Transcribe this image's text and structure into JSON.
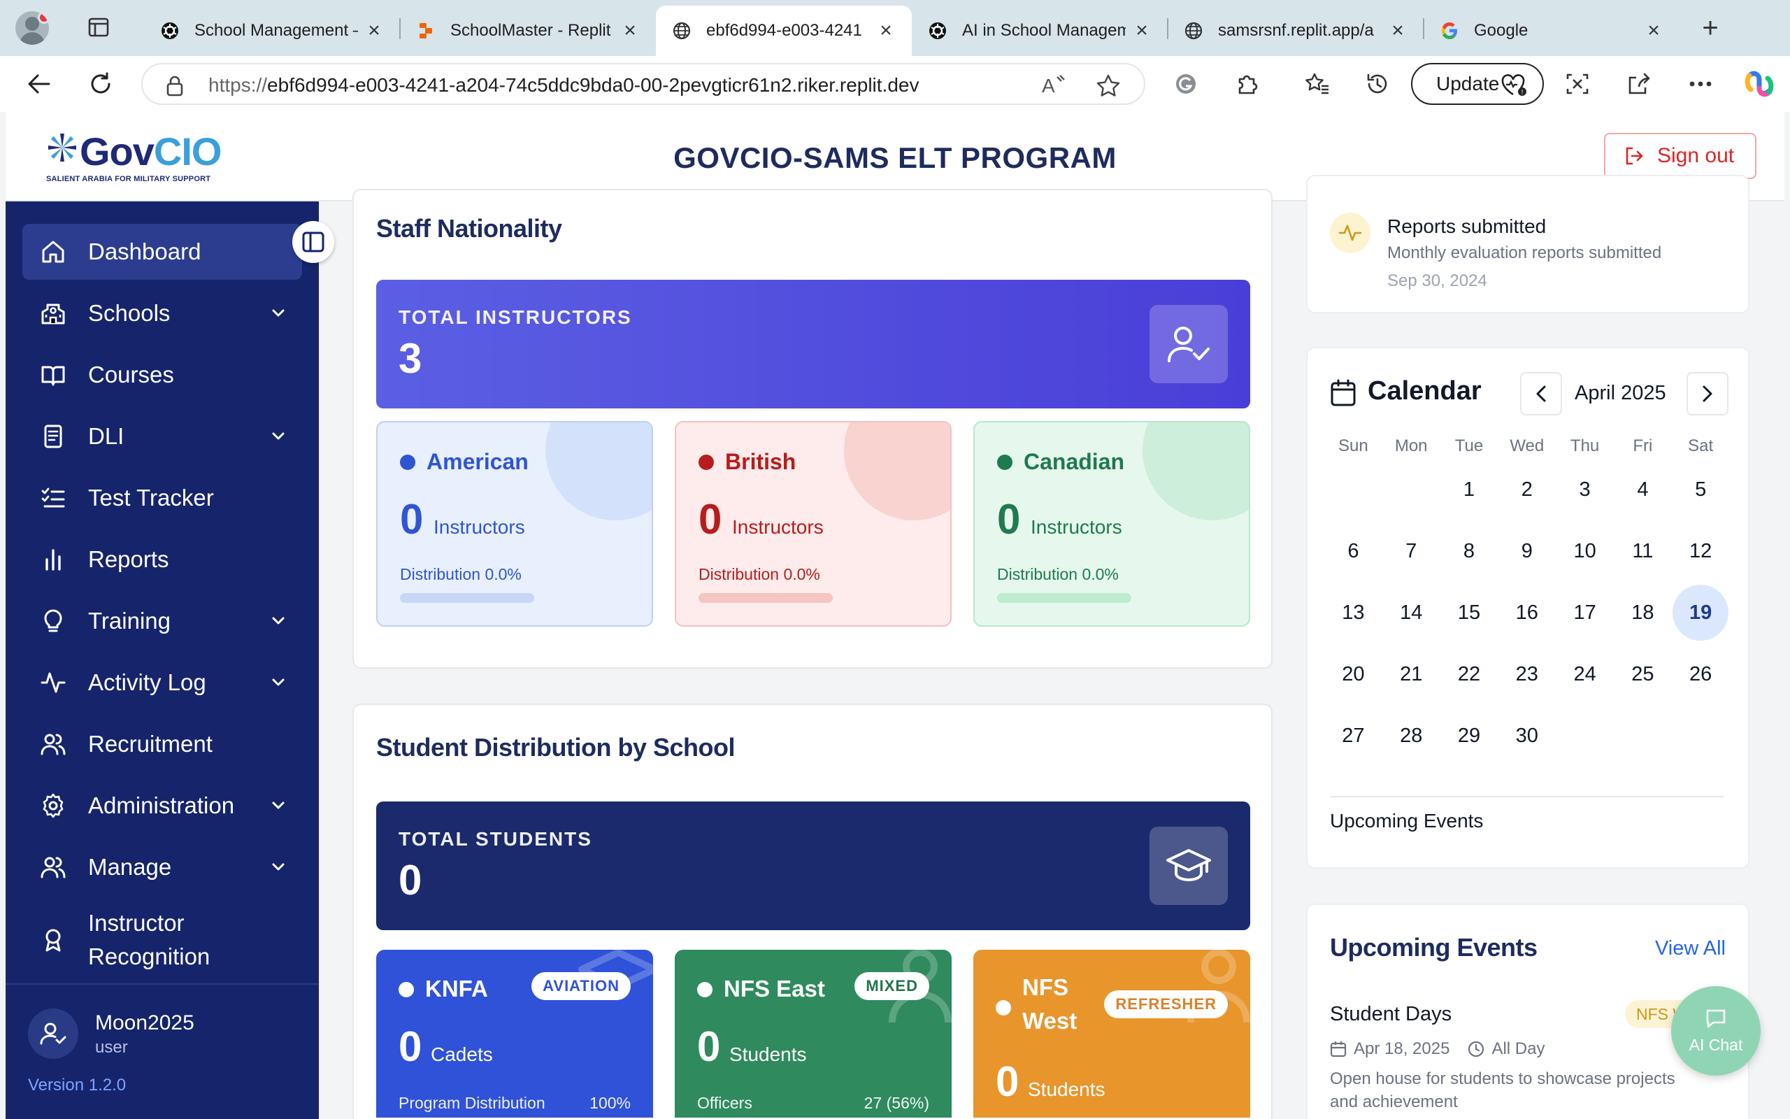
{
  "browser": {
    "tabs": [
      {
        "title": "School Management —",
        "icon": "openai-icon",
        "active": false
      },
      {
        "title": "SchoolMaster - Replit",
        "icon": "replit-icon",
        "active": false
      },
      {
        "title": "ebf6d994-e003-4241",
        "icon": "globe-icon",
        "active": true
      },
      {
        "title": "AI in School Managem",
        "icon": "openai-icon",
        "active": false
      },
      {
        "title": "samsrsnf.replit.app/a",
        "icon": "globe-icon",
        "active": false
      },
      {
        "title": "Google",
        "icon": "google-icon",
        "active": false
      }
    ],
    "url_proto": "https://",
    "url_rest": "ebf6d994-e003-4241-a204-74c5ddc9bda0-00-2pevgticr61n2.riker.replit.dev",
    "update_label": "Update"
  },
  "header": {
    "logo_gov": "Gov",
    "logo_cio": "CIO",
    "logo_tagline": "SALIENT ARABIA FOR MILITARY SUPPORT",
    "title": "GOVCIO-SAMS ELT PROGRAM",
    "signout_label": "Sign out"
  },
  "sidebar": {
    "items": [
      {
        "label": "Dashboard",
        "icon": "home-icon",
        "active": true,
        "expandable": false
      },
      {
        "label": "Schools",
        "icon": "school-icon",
        "active": false,
        "expandable": true
      },
      {
        "label": "Courses",
        "icon": "book-open-icon",
        "active": false,
        "expandable": false
      },
      {
        "label": "DLI",
        "icon": "document-icon",
        "active": false,
        "expandable": true
      },
      {
        "label": "Test Tracker",
        "icon": "checklist-icon",
        "active": false,
        "expandable": false
      },
      {
        "label": "Reports",
        "icon": "bar-chart-icon",
        "active": false,
        "expandable": false
      },
      {
        "label": "Training",
        "icon": "lightbulb-icon",
        "active": false,
        "expandable": true
      },
      {
        "label": "Activity Log",
        "icon": "activity-icon",
        "active": false,
        "expandable": true
      },
      {
        "label": "Recruitment",
        "icon": "users-icon",
        "active": false,
        "expandable": false
      },
      {
        "label": "Administration",
        "icon": "gear-icon",
        "active": false,
        "expandable": true
      },
      {
        "label": "Manage",
        "icon": "users-icon",
        "active": false,
        "expandable": true
      },
      {
        "label": "Instructor Recognition",
        "icon": "award-icon",
        "active": false,
        "expandable": false
      }
    ],
    "user_name": "Moon2025",
    "user_role": "user",
    "version": "Version 1.2.0"
  },
  "staff_nationality": {
    "title": "Staff Nationality",
    "banner_label": "TOTAL INSTRUCTORS",
    "banner_value": "3",
    "cards": [
      {
        "name": "American",
        "count": "0",
        "unit": "Instructors",
        "dist_label": "Distribution",
        "dist_value": "0.0%",
        "fraction": 0.0,
        "color": "#2f55d4",
        "bg": "#e8f0fd",
        "border": "#bcd0f5",
        "bubble": "#d3e1fb",
        "track": "#c8d7f6"
      },
      {
        "name": "British",
        "count": "0",
        "unit": "Instructors",
        "dist_label": "Distribution",
        "dist_value": "0.0%",
        "fraction": 0.0,
        "color": "#b91c1c",
        "bg": "#fdeceb",
        "border": "#f5c1bd",
        "bubble": "#f8d3d0",
        "track": "#f4c5c1"
      },
      {
        "name": "Canadian",
        "count": "0",
        "unit": "Instructors",
        "dist_label": "Distribution",
        "dist_value": "0.0%",
        "fraction": 0.0,
        "color": "#1f7a4f",
        "bg": "#e6f8ee",
        "border": "#b6e8cb",
        "bubble": "#cdeedb",
        "track": "#bdeccf"
      }
    ]
  },
  "student_distribution": {
    "title": "Student Distribution by School",
    "banner_label": "TOTAL STUDENTS",
    "banner_value": "0",
    "cards": [
      {
        "name": "KNFA",
        "tag": "AVIATION",
        "count": "0",
        "unit": "Cadets",
        "foot_left": "Program Distribution",
        "foot_right": "100%",
        "color": "#2f52d9",
        "tag_color": "#2f52d9"
      },
      {
        "name": "NFS East",
        "tag": "MIXED",
        "count": "0",
        "unit": "Students",
        "foot_left": "Officers",
        "foot_right": "27 (56%)",
        "color": "#2f8a5e",
        "tag_color": "#22754d"
      },
      {
        "name": "NFS West",
        "tag": "REFRESHER",
        "count": "0",
        "unit": "Students",
        "foot_left": "",
        "foot_right": "",
        "color": "#e8952c",
        "tag_color": "#d9822b"
      }
    ]
  },
  "recent_activity": {
    "title": "Reports submitted",
    "subtitle": "Monthly evaluation reports submitted",
    "date": "Sep 30, 2024"
  },
  "calendar": {
    "title": "Calendar",
    "month": "April 2025",
    "weekdays": [
      "Sun",
      "Mon",
      "Tue",
      "Wed",
      "Thu",
      "Fri",
      "Sat"
    ],
    "today": 19,
    "days_in_month": 30,
    "first_weekday": 2,
    "upcoming_label": "Upcoming Events"
  },
  "upcoming_events": {
    "title": "Upcoming Events",
    "view_all": "View All",
    "event": {
      "title": "Student Days",
      "badge": "NFS W",
      "date": "Apr 18, 2025",
      "time": "All Day",
      "description": "Open house for students to showcase projects and achievement"
    }
  },
  "ai_chat": {
    "label": "AI Chat"
  },
  "colors": {
    "sidebar": "#16246b",
    "sidebar_active": "#2c3d8f",
    "title_navy": "#1e2b5e",
    "instructors_banner": "#5a52e0",
    "students_banner": "#1a2a6c",
    "signout_red": "#dc2626",
    "link_blue": "#2563eb"
  }
}
